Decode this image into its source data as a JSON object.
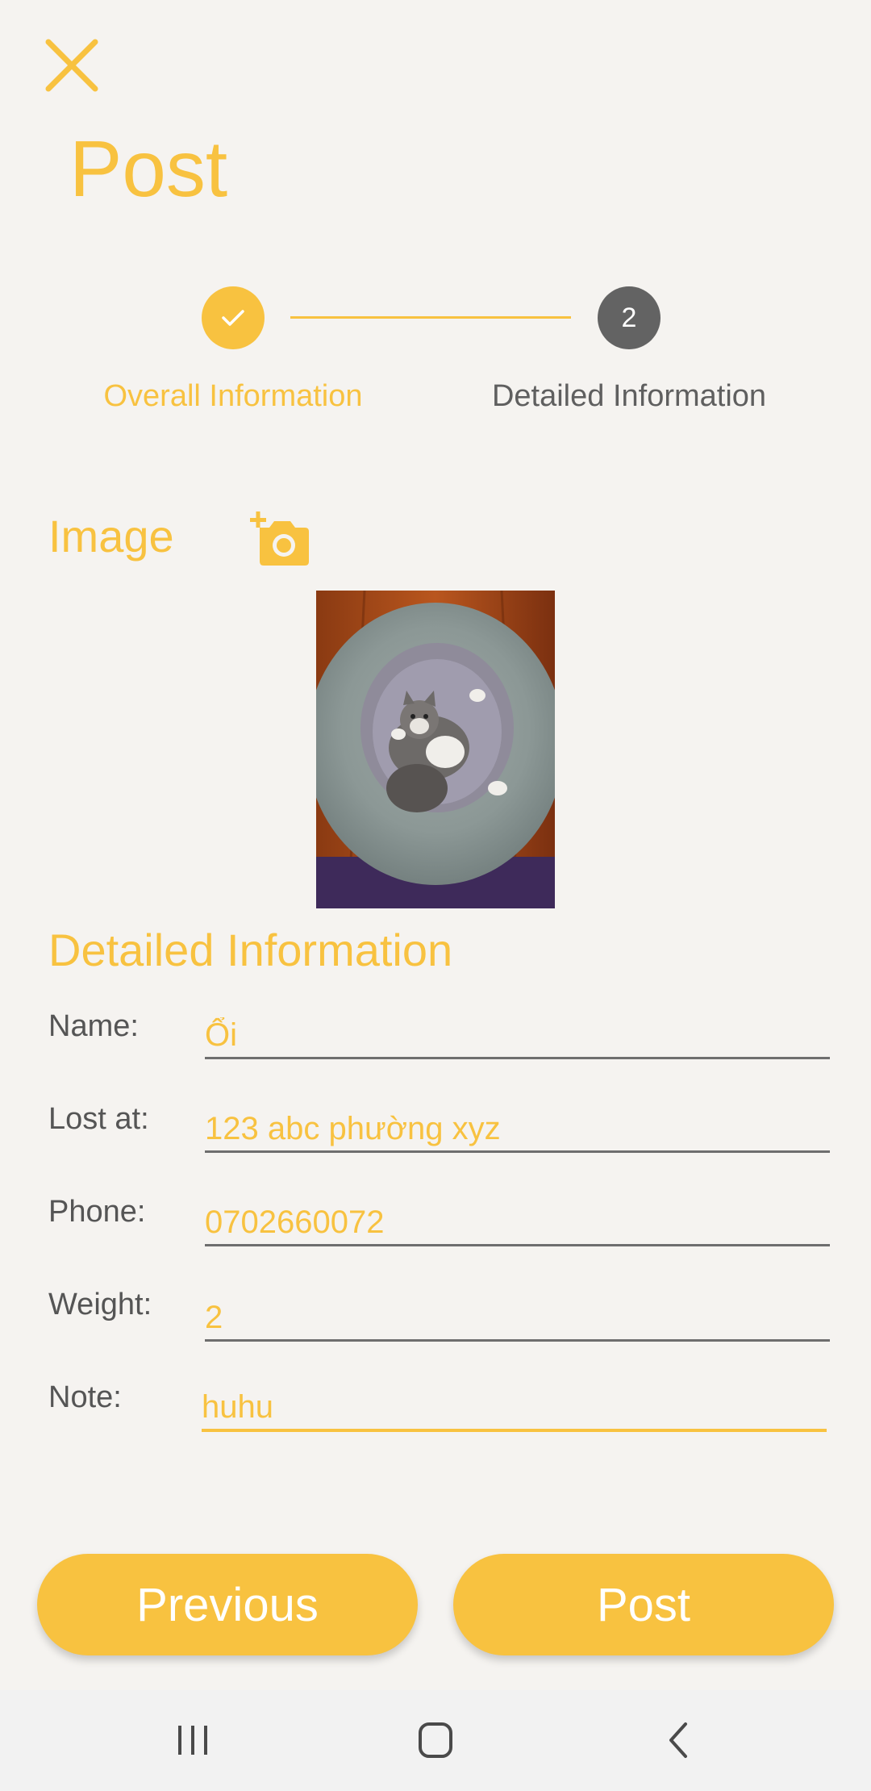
{
  "header": {
    "close_icon": "close-icon",
    "title": "Post"
  },
  "stepper": {
    "steps": [
      {
        "label": "Overall Information",
        "status": "completed",
        "icon": "check-icon"
      },
      {
        "label": "Detailed Information",
        "status": "current",
        "number": "2"
      }
    ],
    "active_color": "#f8c240",
    "inactive_color": "#636363"
  },
  "image_section": {
    "label": "Image",
    "add_icon": "add-photo-icon"
  },
  "details": {
    "heading": "Detailed Information",
    "fields": [
      {
        "label": "Name:",
        "value": "Ổi"
      },
      {
        "label": "Lost at:",
        "value": "123 abc phường xyz"
      },
      {
        "label": "Phone:",
        "value": "0702660072"
      },
      {
        "label": "Weight:",
        "value": "2"
      },
      {
        "label": "Note:",
        "value": "huhu"
      }
    ]
  },
  "buttons": {
    "previous": "Previous",
    "post": "Post"
  },
  "nav": {
    "recent_icon": "recent-apps-icon",
    "home_icon": "home-icon",
    "back_icon": "back-icon"
  },
  "colors": {
    "accent": "#f8c240",
    "background": "#f5f3f0",
    "text_gray": "#555555"
  }
}
